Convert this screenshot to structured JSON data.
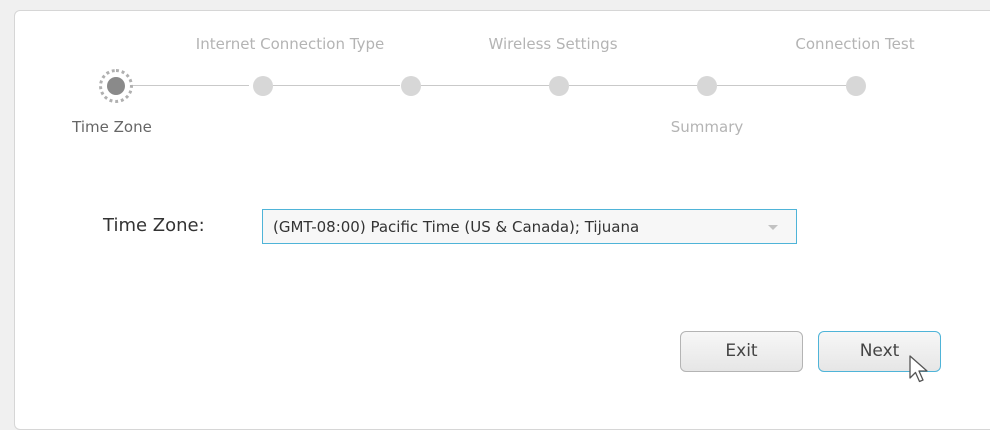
{
  "wizard": {
    "steps": [
      {
        "label": "Time Zone",
        "state": "active"
      },
      {
        "label": "Internet Connection Type",
        "state": "pending"
      },
      {
        "label": "Wireless Settings",
        "state": "pending"
      },
      {
        "label": "",
        "state": "pending"
      },
      {
        "label": "Summary",
        "state": "pending"
      },
      {
        "label": "Connection Test",
        "state": "pending"
      }
    ]
  },
  "form": {
    "timezone_label": "Time Zone:",
    "timezone_value": "(GMT-08:00) Pacific Time (US & Canada); Tijuana"
  },
  "buttons": {
    "exit_label": "Exit",
    "next_label": "Next"
  },
  "colors": {
    "accent": "#4fb4d8",
    "active_dot": "#8a8a8a",
    "pending_dot": "#d7d7d7"
  },
  "icons": {
    "dropdown": "chevron-down-icon",
    "cursor": "mouse-pointer-icon"
  }
}
